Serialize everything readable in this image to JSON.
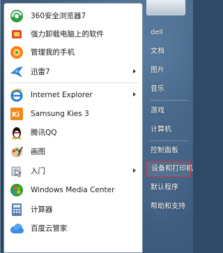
{
  "left_items": [
    {
      "label": "360安全浏览器7",
      "icon": "browser-360-icon",
      "submenu": false
    },
    {
      "label": "强力卸载电脑上的软件",
      "icon": "uninstall-icon",
      "submenu": false
    },
    {
      "label": "管理我的手机",
      "icon": "phone-manager-icon",
      "submenu": false
    },
    {
      "label": "迅雷7",
      "icon": "thunder-bird-icon",
      "submenu": true
    },
    {
      "label": "Internet Explorer",
      "icon": "internet-explorer-icon",
      "submenu": true
    },
    {
      "label": "Samsung Kies 3",
      "icon": "kies-icon",
      "submenu": false
    },
    {
      "label": "腾讯QQ",
      "icon": "qq-penguin-icon",
      "submenu": false
    },
    {
      "label": "画图",
      "icon": "paint-icon",
      "submenu": false
    },
    {
      "label": "入门",
      "icon": "getting-started-icon",
      "submenu": true
    },
    {
      "label": "Windows Media Center",
      "icon": "media-center-icon",
      "submenu": false
    },
    {
      "label": "计算器",
      "icon": "calculator-icon",
      "submenu": false
    },
    {
      "label": "百度云管家",
      "icon": "baidu-cloud-icon",
      "submenu": false
    }
  ],
  "right_items": [
    {
      "label": "dell"
    },
    {
      "label": "文档"
    },
    {
      "label": "图片"
    },
    {
      "label": "音乐"
    },
    {
      "label": "游戏"
    },
    {
      "label": "计算机"
    },
    {
      "label": "控制面板"
    },
    {
      "label": "设备和打印机",
      "highlighted": true
    },
    {
      "label": "默认程序"
    },
    {
      "label": "帮助和支持"
    }
  ],
  "colors": {
    "highlight_border": "#e0303a",
    "right_text": "#ffffff"
  }
}
